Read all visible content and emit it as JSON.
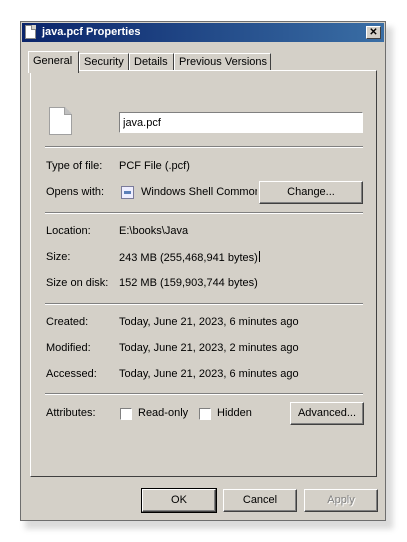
{
  "window": {
    "title": "java.pcf Properties",
    "close_label": "✕"
  },
  "tabs": [
    {
      "label": "General",
      "active": true
    },
    {
      "label": "Security",
      "active": false
    },
    {
      "label": "Details",
      "active": false
    },
    {
      "label": "Previous Versions",
      "active": false
    }
  ],
  "general": {
    "file_name": "java.pcf",
    "type_label": "Type of file:",
    "type_value": "PCF File (.pcf)",
    "opens_label": "Opens with:",
    "opens_value": "Windows Shell Common",
    "change_button": "Change...",
    "location_label": "Location:",
    "location_value": "E:\\books\\Java",
    "size_label": "Size:",
    "size_value": "243 MB (255,468,941 bytes)",
    "size_on_disk_label": "Size on disk:",
    "size_on_disk_value": "152 MB (159,903,744 bytes)",
    "created_label": "Created:",
    "created_value": "Today, June 21, 2023, 6 minutes ago",
    "modified_label": "Modified:",
    "modified_value": "Today, June 21, 2023, 2 minutes ago",
    "accessed_label": "Accessed:",
    "accessed_value": "Today, June 21, 2023, 6 minutes ago",
    "attributes_label": "Attributes:",
    "readonly_label": "Read-only",
    "readonly_checked": false,
    "hidden_label": "Hidden",
    "hidden_checked": false,
    "advanced_button": "Advanced..."
  },
  "footer": {
    "ok": "OK",
    "cancel": "Cancel",
    "apply": "Apply"
  },
  "colors": {
    "titlebar_start": "#0a246a",
    "titlebar_end": "#3a6ea5",
    "face": "#d4d0c8"
  }
}
